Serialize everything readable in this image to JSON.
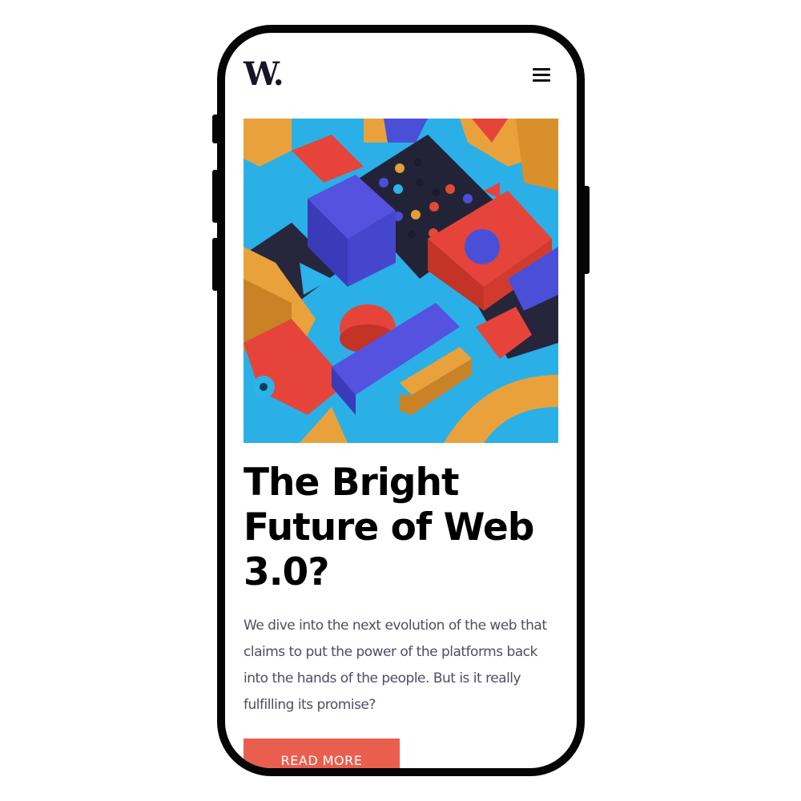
{
  "header": {
    "logo_text": "W.",
    "menu_icon": "hamburger-menu-icon"
  },
  "hero": {
    "image": "colorful-3d-geometric-blocks-illustration"
  },
  "article": {
    "title_line_1": "The Bright",
    "title_line_2": "Future of Web",
    "title_line_3": "3.0?",
    "excerpt_line_1": "We dive into the next evolution of the web that",
    "excerpt_line_2": "claims to put the power of the platforms back",
    "excerpt_line_3": "into the hands of the people. But is it really",
    "excerpt_line_4": "fulfilling its promise?",
    "cta_label": "READ MORE"
  },
  "colors": {
    "accent": "#ea5e4d",
    "logo": "#16152b",
    "body_text": "#4d4d66",
    "frame": "#050505"
  }
}
